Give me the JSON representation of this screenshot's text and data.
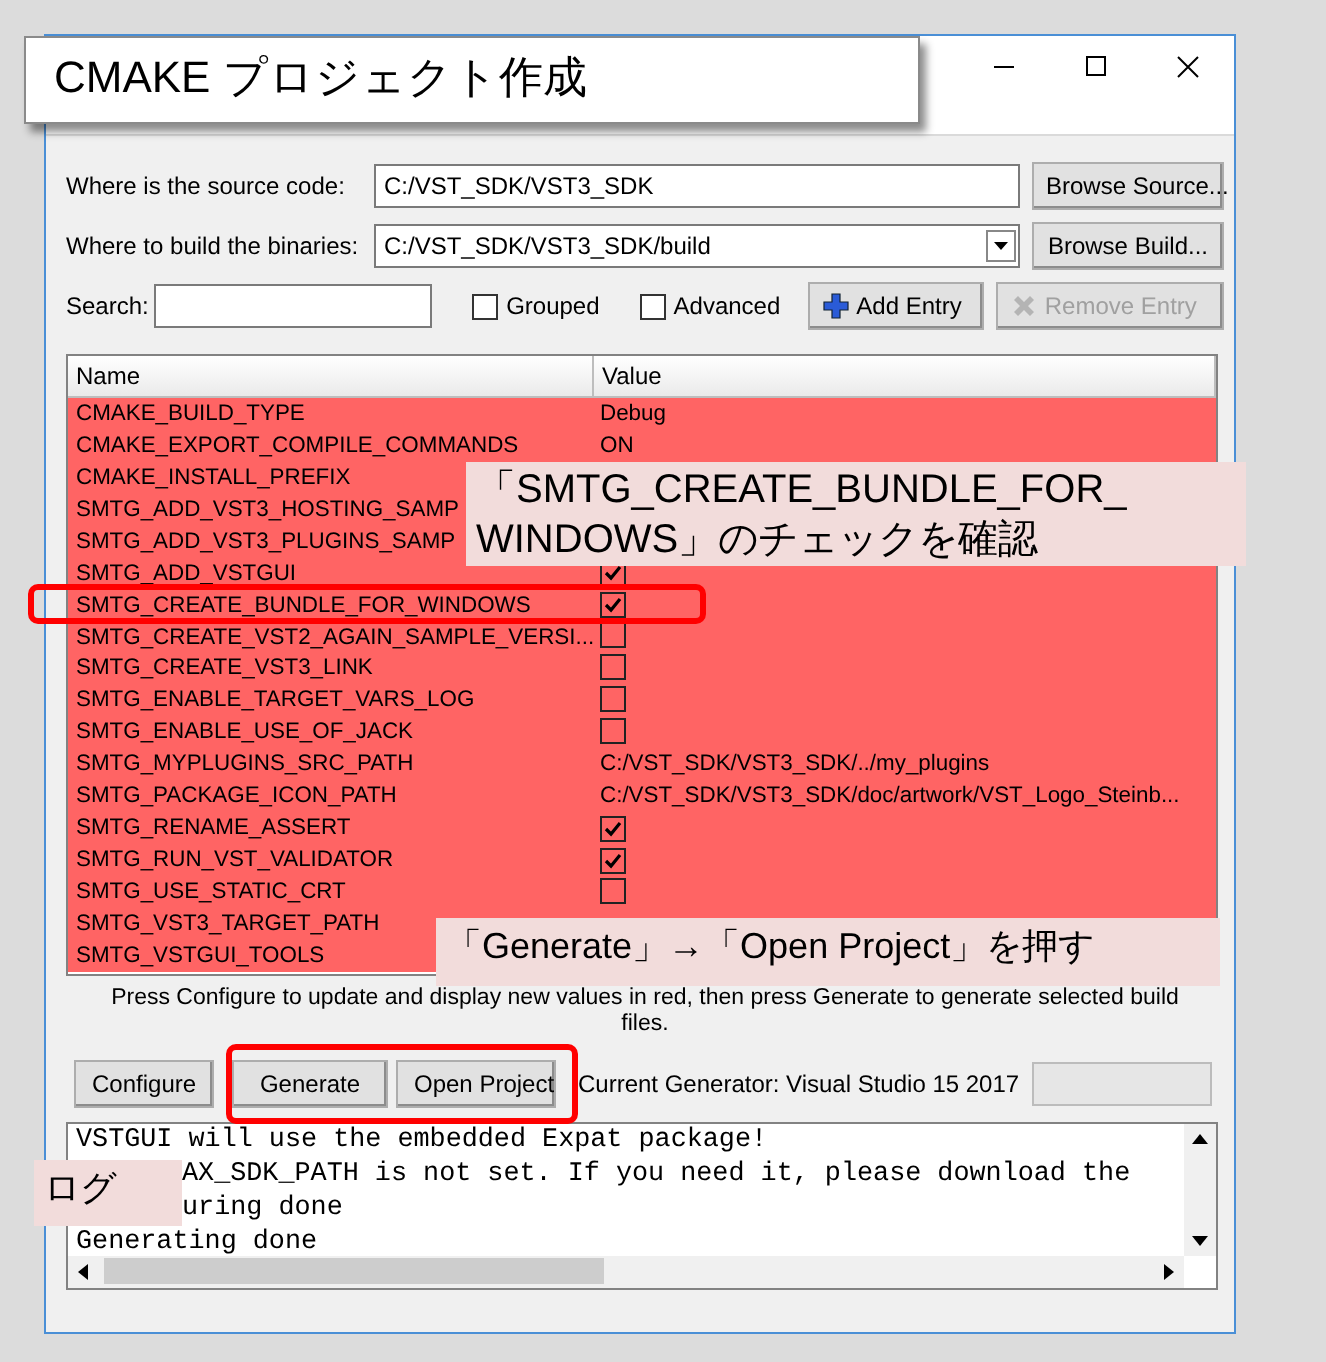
{
  "source": {
    "label": "Where is the source code:",
    "value": "C:/VST_SDK/VST3_SDK",
    "button": "Browse Source..."
  },
  "build": {
    "label": "Where to build the binaries:",
    "value": "C:/VST_SDK/VST3_SDK/build",
    "button": "Browse Build..."
  },
  "search": {
    "label": "Search:"
  },
  "options": [
    {
      "label": "Grouped",
      "checked": false
    },
    {
      "label": "Advanced",
      "checked": false
    }
  ],
  "entry_buttons": [
    {
      "label": "Add Entry",
      "disabled": false
    },
    {
      "label": "Remove Entry",
      "disabled": true
    }
  ],
  "table": {
    "columns": [
      "Name",
      "Value"
    ],
    "rows": [
      {
        "name": "CMAKE_BUILD_TYPE",
        "new": true,
        "kind": "text",
        "value": "Debug"
      },
      {
        "name": "CMAKE_EXPORT_COMPILE_COMMANDS",
        "new": true,
        "kind": "text",
        "value": "ON"
      },
      {
        "name": "CMAKE_INSTALL_PREFIX",
        "new": true
      },
      {
        "name": "SMTG_ADD_VST3_HOSTING_SAMP",
        "new": true
      },
      {
        "name": "SMTG_ADD_VST3_PLUGINS_SAMP",
        "new": true
      },
      {
        "name": "SMTG_ADD_VSTGUI",
        "new": true,
        "kind": "check",
        "checked": true
      },
      {
        "name": "SMTG_CREATE_BUNDLE_FOR_WINDOWS",
        "new": true,
        "kind": "check",
        "checked": true
      },
      {
        "name": "SMTG_CREATE_VST2_AGAIN_SAMPLE_VERSI...",
        "new": true,
        "kind": "check",
        "checked": false
      },
      {
        "name": "SMTG_CREATE_VST3_LINK",
        "new": true,
        "kind": "check",
        "checked": false
      },
      {
        "name": "SMTG_ENABLE_TARGET_VARS_LOG",
        "new": true,
        "kind": "check",
        "checked": false
      },
      {
        "name": "SMTG_ENABLE_USE_OF_JACK",
        "new": true,
        "kind": "check",
        "checked": false
      },
      {
        "name": "SMTG_MYPLUGINS_SRC_PATH",
        "new": true,
        "kind": "text",
        "value": "C:/VST_SDK/VST3_SDK/../my_plugins"
      },
      {
        "name": "SMTG_PACKAGE_ICON_PATH",
        "new": true,
        "kind": "text",
        "value": "C:/VST_SDK/VST3_SDK/doc/artwork/VST_Logo_Steinb..."
      },
      {
        "name": "SMTG_RENAME_ASSERT",
        "new": true,
        "kind": "check",
        "checked": true
      },
      {
        "name": "SMTG_RUN_VST_VALIDATOR",
        "new": true,
        "kind": "check",
        "checked": true
      },
      {
        "name": "SMTG_USE_STATIC_CRT",
        "new": true,
        "kind": "check",
        "checked": false
      },
      {
        "name": "SMTG_VST3_TARGET_PATH",
        "new": true
      },
      {
        "name": "SMTG_VSTGUI_TOOLS",
        "new": true
      }
    ]
  },
  "hint": "Press Configure to update and display new values in red, then press Generate to generate selected build files.",
  "actions": [
    "Configure",
    "Generate",
    "Open Project"
  ],
  "generator": "Current Generator: Visual Studio 15 2017",
  "progress": {
    "level": 0
  },
  "log": [
    {
      "text": "VSTGUI will use the embedded Expat package!",
      "covered": false
    },
    {
      "text": "AX_SDK_PATH is not set. If you need it, please download the",
      "covered": true
    },
    {
      "text": "uring done",
      "covered": true
    },
    {
      "text": "Generating done",
      "covered": false
    }
  ],
  "callouts": [
    {
      "kind": "title",
      "lines": [
        "CMAKE プロジェクト作成"
      ]
    },
    {
      "kind": "note",
      "lines": [
        "「SMTG_CREATE_BUNDLE_FOR_",
        "WINDOWS」のチェックを確認"
      ]
    },
    {
      "kind": "note",
      "lines": [
        "「Generate」→「Open Project」を押す"
      ]
    },
    {
      "kind": "note",
      "lines": [
        "ログ"
      ]
    }
  ]
}
